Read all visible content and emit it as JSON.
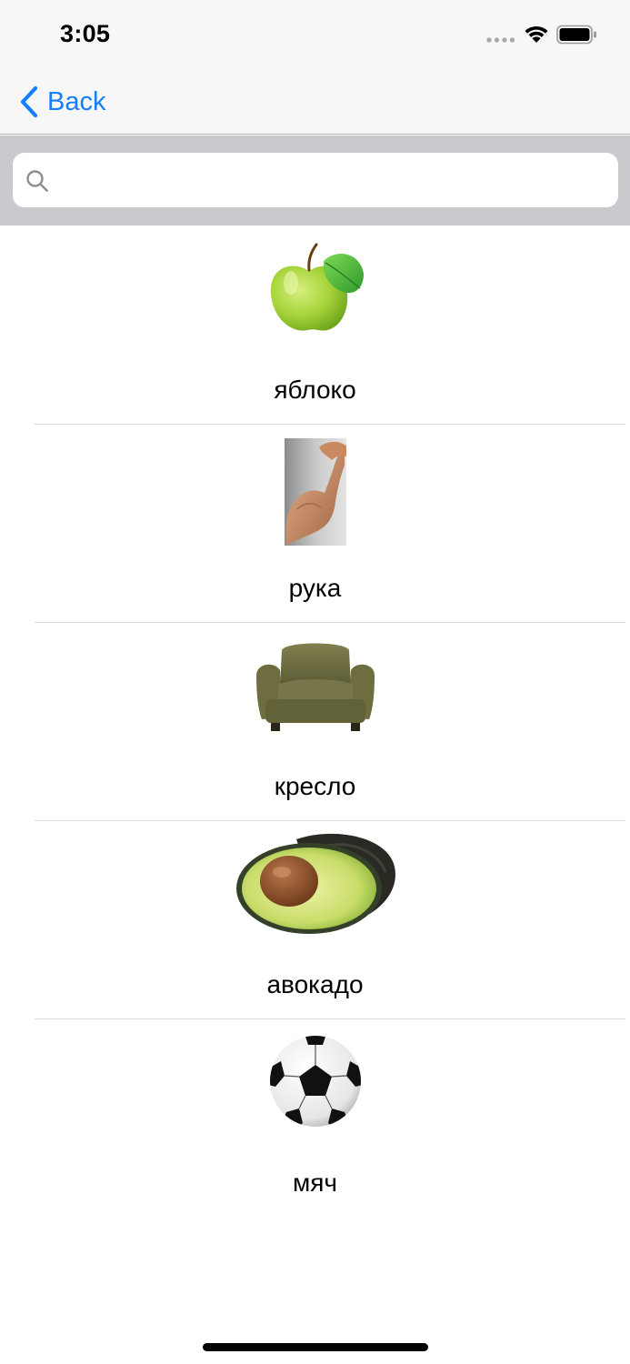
{
  "status_bar": {
    "time": "3:05",
    "icons": [
      "signal-dots-icon",
      "wifi-icon",
      "battery-icon"
    ]
  },
  "nav": {
    "back_label": "Back",
    "accent_color": "#147efb"
  },
  "search": {
    "value": "",
    "placeholder": "",
    "icon": "search-icon"
  },
  "items": [
    {
      "label": "яблоко",
      "image": "green-apple"
    },
    {
      "label": "рука",
      "image": "flexed-arm"
    },
    {
      "label": "кресло",
      "image": "olive-armchair"
    },
    {
      "label": "авокадо",
      "image": "halved-avocado"
    },
    {
      "label": "мяч",
      "image": "soccer-ball"
    }
  ]
}
